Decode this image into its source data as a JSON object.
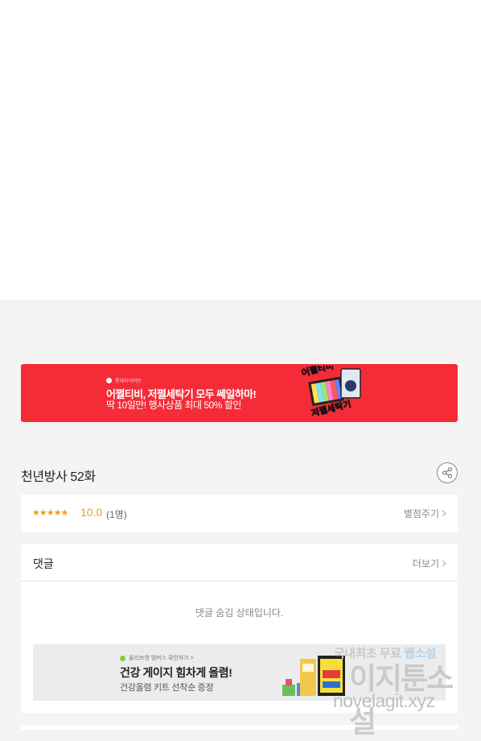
{
  "banner": {
    "brand": "롯데하이마트",
    "headline": "어쩔티비, 저쩔세탁기 모두 쎄일하마!",
    "subline": "딱 10일만! 행사상품 최대 50% 할인",
    "art_top": "어쩔티비",
    "art_bottom": "저쩔세탁기",
    "accent_color": "#f52b37"
  },
  "episode": {
    "title": "천년방사 52화",
    "share_icon": "share-icon"
  },
  "rating": {
    "stars": "★★★★★",
    "score": "10.0",
    "count": "(1명)",
    "rate_link": "별점주기",
    "star_color": "#f0a017"
  },
  "comments": {
    "label": "댓글",
    "more_link": "더보기",
    "hidden_message": "댓글 숨김 상태입니다."
  },
  "ad": {
    "brand": "올리브영 멤버스 확인하기 >",
    "title": "건강 게이지 힘차게 올렴!",
    "subtitle": "건강올렴 키트 선착순 증정"
  },
  "watermark": {
    "top_line_part1": "국내최초 무료 ",
    "top_line_part2": "웹소설",
    "main": "이지툰소설",
    "url": "novelagit.xyz"
  }
}
